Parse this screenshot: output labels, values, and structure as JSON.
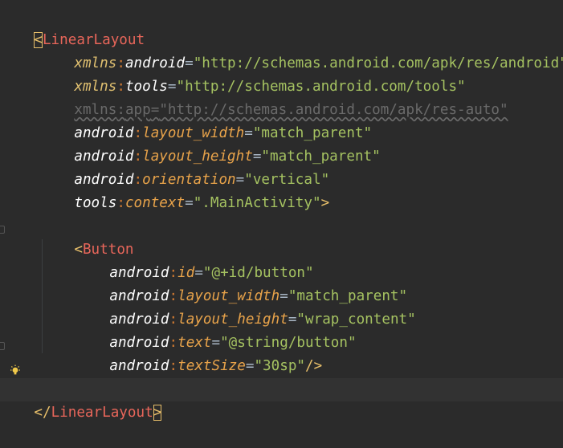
{
  "code": {
    "root_open_tag": "LinearLayout",
    "root_attrs": [
      {
        "ns": "xmlns",
        "name": "android",
        "value": "\"http://schemas.android.com/apk/res/android\""
      },
      {
        "ns": "xmlns",
        "name": "tools",
        "value": "\"http://schemas.android.com/tools\""
      },
      {
        "ns": "xmlns",
        "name": "app",
        "value": "\"http://schemas.android.com/apk/res-auto\""
      },
      {
        "ns": "android",
        "name": "layout_width",
        "value": "\"match_parent\""
      },
      {
        "ns": "android",
        "name": "layout_height",
        "value": "\"match_parent\""
      },
      {
        "ns": "android",
        "name": "orientation",
        "value": "\"vertical\""
      },
      {
        "ns": "tools",
        "name": "context",
        "value": "\".MainActivity\""
      }
    ],
    "child_tag": "Button",
    "child_attrs": [
      {
        "ns": "android",
        "name": "id",
        "value": "\"@+id/button\""
      },
      {
        "ns": "android",
        "name": "layout_width",
        "value": "\"match_parent\""
      },
      {
        "ns": "android",
        "name": "layout_height",
        "value": "\"wrap_content\""
      },
      {
        "ns": "android",
        "name": "text",
        "value": "\"@string/button\""
      },
      {
        "ns": "android",
        "name": "textSize",
        "value": "\"30sp\""
      }
    ],
    "root_close_tag": "LinearLayout",
    "lt": "<",
    "gt": ">",
    "close_lt": "</",
    "self_close": "/>",
    "colon": ":",
    "eq": "="
  },
  "colors": {
    "background": "#2b2b2b",
    "current_line": "#323232",
    "tag": "#e8665a",
    "attr_name": "#e8a34a",
    "value": "#a5c261"
  },
  "icons": [
    "lightbulb-icon",
    "fold-marker-icon"
  ]
}
